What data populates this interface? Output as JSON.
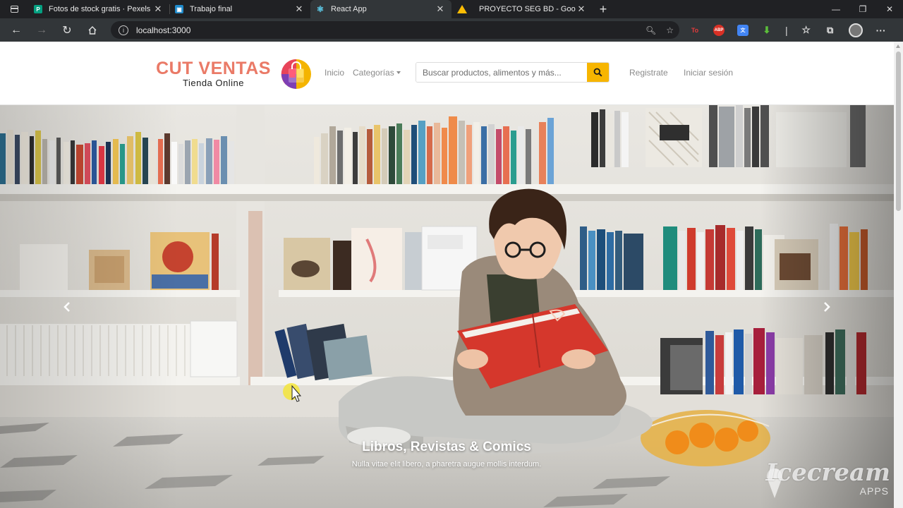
{
  "browser": {
    "tabs": [
      {
        "title": "Fotos de stock gratis · Pexels",
        "favicon": "pexels-icon",
        "active": false
      },
      {
        "title": "Trabajo final",
        "favicon": "trabajo-icon",
        "active": false
      },
      {
        "title": "React App",
        "favicon": "react-icon",
        "active": true
      },
      {
        "title": "PROYECTO SEG BD - Google Drive",
        "favicon": "drive-icon",
        "active": false
      }
    ],
    "new_tab": "+",
    "url": "localhost:3000",
    "extensions": [
      "to-extension-icon",
      "abp-icon",
      "translate-icon",
      "download-icon"
    ],
    "ext_labels": {
      "to": "To",
      "abp": "ABP"
    }
  },
  "site": {
    "brand_name": "CUT VENTAS",
    "brand_tagline": "Tienda Online",
    "nav": {
      "home": "Inicio",
      "categories": "Categorías"
    },
    "search": {
      "placeholder": "Buscar productos, alimentos y más..."
    },
    "auth": {
      "register": "Registrate",
      "login": "Iniciar sesión"
    },
    "colors": {
      "brand": "#ea7a67",
      "search_button": "#f7b500"
    }
  },
  "carousel": {
    "slide_title": "Libros, Revistas & Comics",
    "slide_text": "Nulla vitae elit libero, a pharetra augue mollis interdum.",
    "slide_count": 5,
    "active_index": 0
  },
  "watermark": {
    "name": "Icecream",
    "sub": "APPS"
  }
}
